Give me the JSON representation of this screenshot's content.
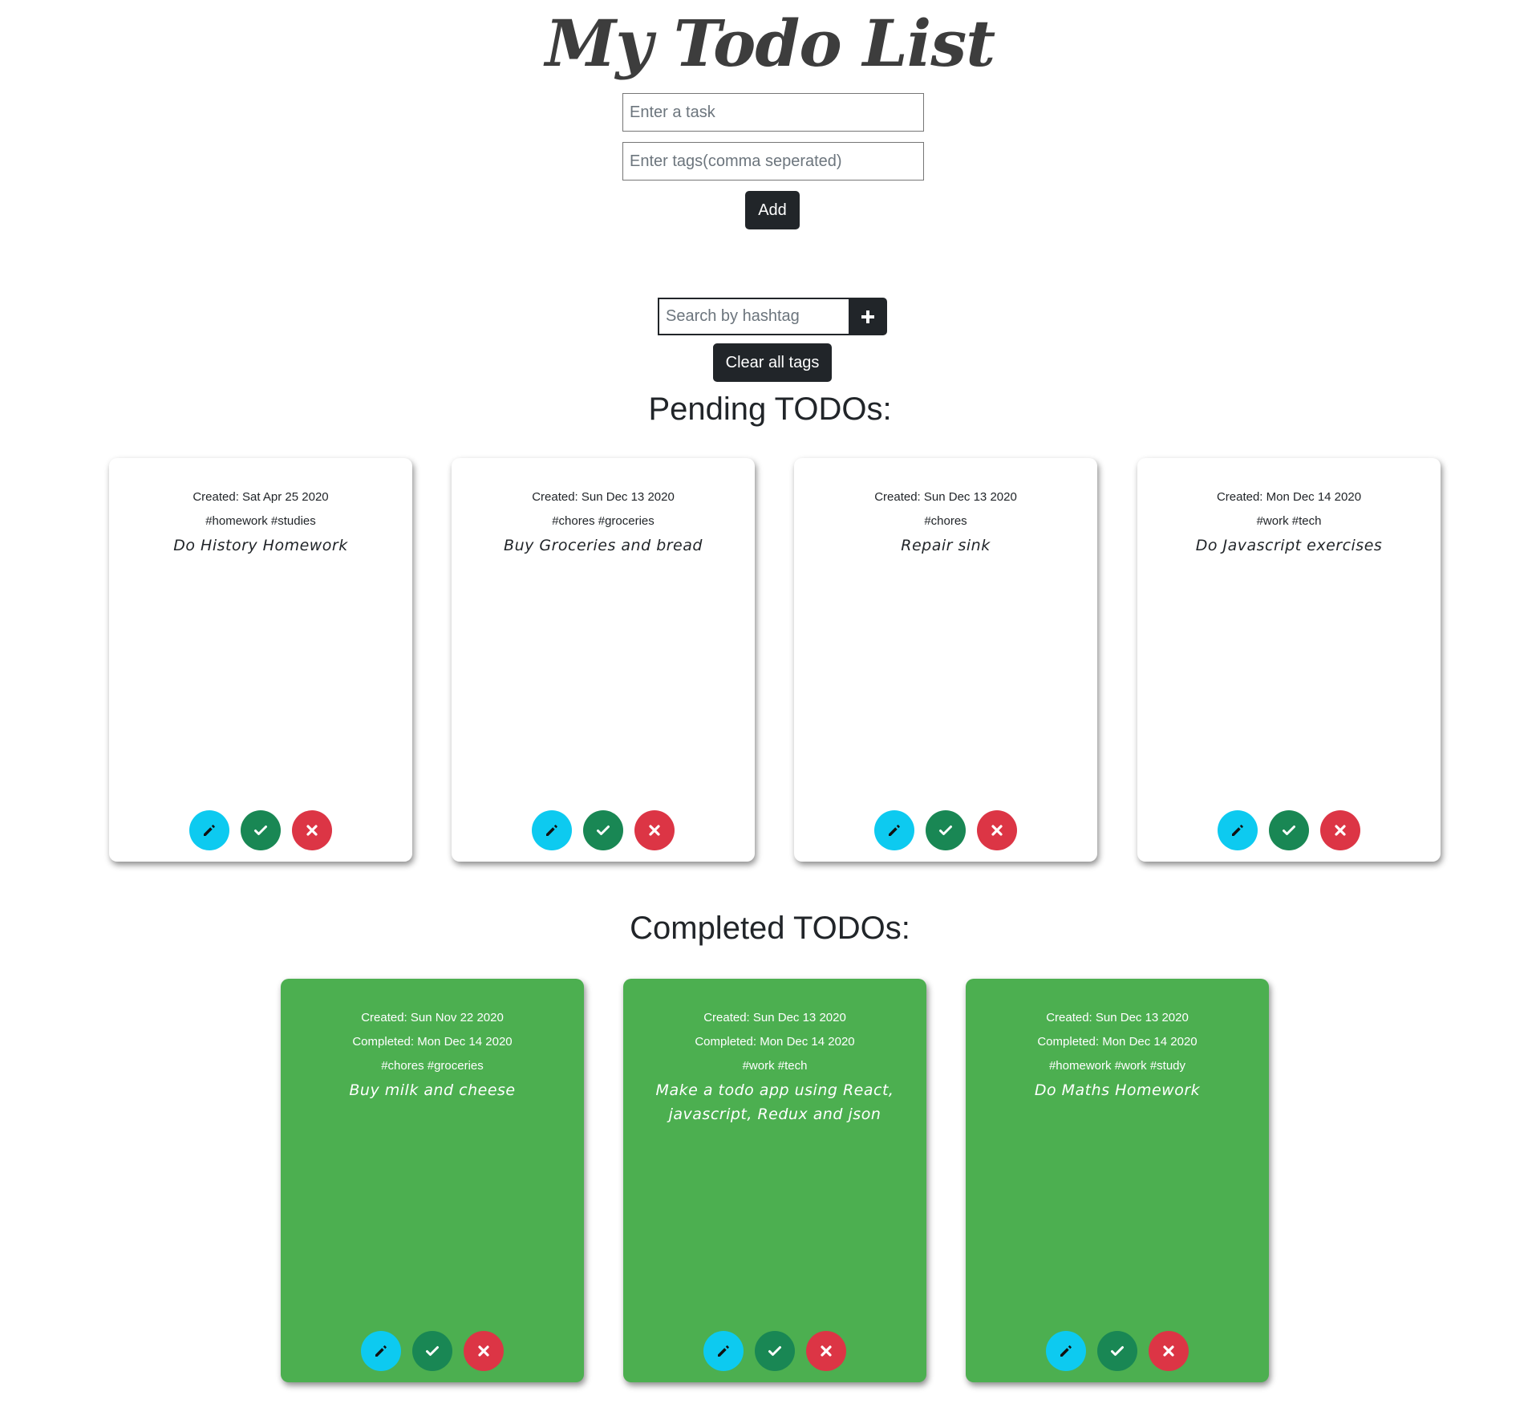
{
  "app": {
    "title": "My Todo List"
  },
  "form": {
    "task_placeholder": "Enter a task",
    "task_value": "",
    "tags_placeholder": "Enter tags(comma seperated)",
    "tags_value": "",
    "add_label": "Add"
  },
  "search": {
    "placeholder": "Search by hashtag",
    "value": "",
    "add_icon": "plus-icon",
    "clear_label": "Clear all tags"
  },
  "pending": {
    "heading": "Pending TODOs:",
    "items": [
      {
        "created": "Created: Sat Apr 25 2020",
        "tags": "#homework #studies",
        "text": "Do History Homework"
      },
      {
        "created": "Created: Sun Dec 13 2020",
        "tags": "#chores #groceries",
        "text": "Buy Groceries and bread"
      },
      {
        "created": "Created: Sun Dec 13 2020",
        "tags": "#chores",
        "text": "Repair sink"
      },
      {
        "created": "Created: Mon Dec 14 2020",
        "tags": "#work #tech",
        "text": "Do Javascript exercises"
      }
    ]
  },
  "completed": {
    "heading": "Completed TODOs:",
    "items": [
      {
        "created": "Created: Sun Nov 22 2020",
        "completed": "Completed: Mon Dec 14 2020",
        "tags": "#chores #groceries",
        "text": "Buy milk and cheese"
      },
      {
        "created": "Created: Sun Dec 13 2020",
        "completed": "Completed: Mon Dec 14 2020",
        "tags": "#work #tech",
        "text": "Make a todo app using React, javascript, Redux and json"
      },
      {
        "created": "Created: Sun Dec 13 2020",
        "completed": "Completed: Mon Dec 14 2020",
        "tags": "#homework #work #study",
        "text": "Do Maths Homework"
      }
    ]
  },
  "icons": {
    "edit": "pencil-icon",
    "complete": "check-icon",
    "delete": "close-icon"
  },
  "colors": {
    "dark_button": "#212529",
    "completed_card": "#4caf50",
    "edit_button": "#0dcaf0",
    "complete_button": "#198754",
    "delete_button": "#dc3545"
  }
}
